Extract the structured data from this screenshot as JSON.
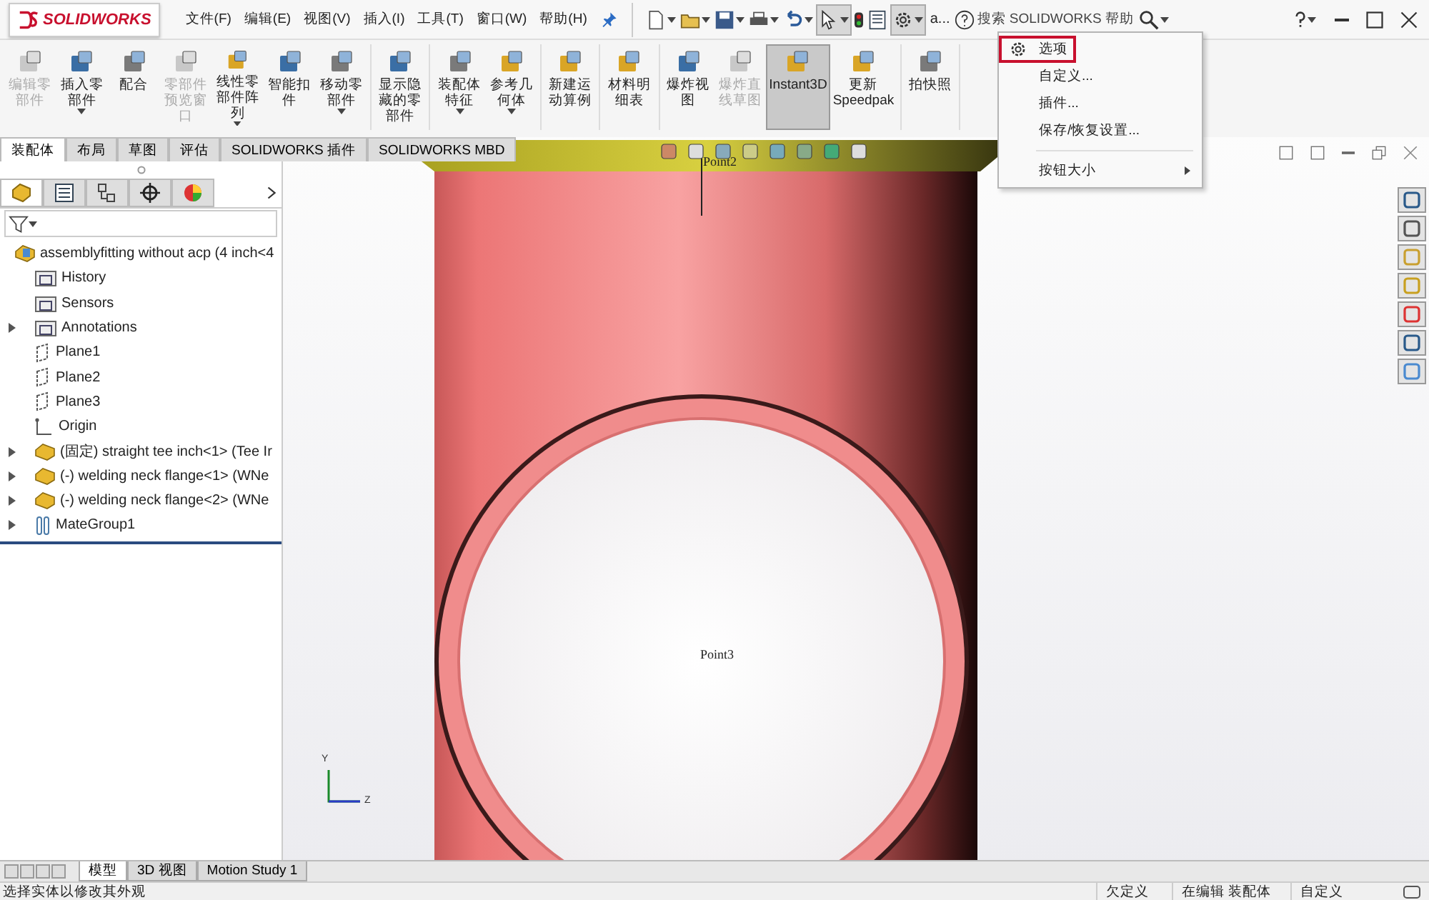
{
  "app": {
    "logo": "SOLIDWORKS"
  },
  "menu": [
    "文件(F)",
    "编辑(E)",
    "视图(V)",
    "插入(I)",
    "工具(T)",
    "窗口(W)",
    "帮助(H)"
  ],
  "toolbar": {
    "more": "a...",
    "search": {
      "placeholder": "搜索 SOLIDWORKS 帮助"
    }
  },
  "options_menu": {
    "items": [
      {
        "label": "选项",
        "kind": "icon",
        "highlighted": true
      },
      {
        "label": "自定义...",
        "kind": "plain",
        "highlighted": false
      },
      {
        "label": "插件...",
        "kind": "plain",
        "highlighted": false
      },
      {
        "label": "保存/恢复设置...",
        "kind": "plain",
        "highlighted": false
      },
      {
        "label": "按钮大小",
        "kind": "submenu",
        "highlighted": false
      }
    ]
  },
  "ribbon": {
    "groups": [
      [
        {
          "label": "编辑零部件",
          "disabled": true,
          "dropdown": false,
          "selected": false
        },
        {
          "label": "插入零部件",
          "disabled": false,
          "dropdown": true,
          "selected": false
        },
        {
          "label": "配合",
          "disabled": false,
          "dropdown": false,
          "selected": false
        },
        {
          "label": "零部件预览窗口",
          "disabled": true,
          "dropdown": false,
          "selected": false
        },
        {
          "label": "线性零部件阵列",
          "disabled": false,
          "dropdown": true,
          "selected": false
        },
        {
          "label": "智能扣件",
          "disabled": false,
          "dropdown": false,
          "selected": false
        },
        {
          "label": "移动零部件",
          "disabled": false,
          "dropdown": true,
          "selected": false
        }
      ],
      [
        {
          "label": "显示隐藏的零部件",
          "disabled": false,
          "dropdown": false,
          "selected": false
        }
      ],
      [
        {
          "label": "装配体特征",
          "disabled": false,
          "dropdown": true,
          "selected": false
        },
        {
          "label": "参考几何体",
          "disabled": false,
          "dropdown": true,
          "selected": false
        }
      ],
      [
        {
          "label": "新建运动算例",
          "disabled": false,
          "dropdown": false,
          "selected": false
        }
      ],
      [
        {
          "label": "材料明细表",
          "disabled": false,
          "dropdown": false,
          "selected": false
        }
      ],
      [
        {
          "label": "爆炸视图",
          "disabled": false,
          "dropdown": false,
          "selected": false
        },
        {
          "label": "爆炸直线草图",
          "disabled": true,
          "dropdown": false,
          "selected": false
        },
        {
          "label": "Instant3D",
          "disabled": false,
          "dropdown": false,
          "selected": true
        },
        {
          "label": "更新Speedpak",
          "disabled": false,
          "dropdown": false,
          "selected": false
        }
      ],
      [
        {
          "label": "拍快照",
          "disabled": false,
          "dropdown": false,
          "selected": false
        }
      ]
    ]
  },
  "command_tabs": [
    {
      "label": "装配体",
      "selected": true
    },
    {
      "label": "布局",
      "selected": false
    },
    {
      "label": "草图",
      "selected": false
    },
    {
      "label": "评估",
      "selected": false
    },
    {
      "label": "SOLIDWORKS 插件",
      "selected": false
    },
    {
      "label": "SOLIDWORKS MBD",
      "selected": false
    }
  ],
  "panel_tabs": [
    {
      "kind": "tree",
      "selected": true
    },
    {
      "kind": "property",
      "selected": false
    },
    {
      "kind": "config",
      "selected": false
    },
    {
      "kind": "dim",
      "selected": false
    },
    {
      "kind": "display",
      "selected": false
    }
  ],
  "tree": {
    "label": "assemblyfitting without acp  (4 inch<4",
    "kind": "assembly",
    "expandable": false,
    "children": [
      {
        "label": "History",
        "kind": "history",
        "expandable": false
      },
      {
        "label": "Sensors",
        "kind": "sensor",
        "expandable": false
      },
      {
        "label": "Annotations",
        "kind": "annotation",
        "expandable": true
      },
      {
        "label": "Plane1",
        "kind": "plane",
        "expandable": false
      },
      {
        "label": "Plane2",
        "kind": "plane",
        "expandable": false
      },
      {
        "label": "Plane3",
        "kind": "plane",
        "expandable": false
      },
      {
        "label": "Origin",
        "kind": "origin",
        "expandable": false
      },
      {
        "label": "(固定) straight tee inch<1> (Tee Ir",
        "kind": "part",
        "expandable": true
      },
      {
        "label": "(-) welding neck flange<1> (WNe",
        "kind": "part",
        "expandable": true
      },
      {
        "label": "(-) welding neck flange<2> (WNe",
        "kind": "part",
        "expandable": true
      },
      {
        "label": "MateGroup1",
        "kind": "mate",
        "expandable": true
      }
    ]
  },
  "viewport": {
    "points": [
      "Point2",
      "Point3"
    ],
    "axes": [
      "Y",
      "Z"
    ]
  },
  "bottom_tabs": [
    {
      "label": "模型",
      "selected": true
    },
    {
      "label": "3D 视图",
      "selected": false
    },
    {
      "label": "Motion Study 1",
      "selected": false
    }
  ],
  "status_bar": {
    "message": "选择实体以修改其外观",
    "state": "欠定义",
    "mode": "在编辑 装配体",
    "units": "自定义"
  }
}
